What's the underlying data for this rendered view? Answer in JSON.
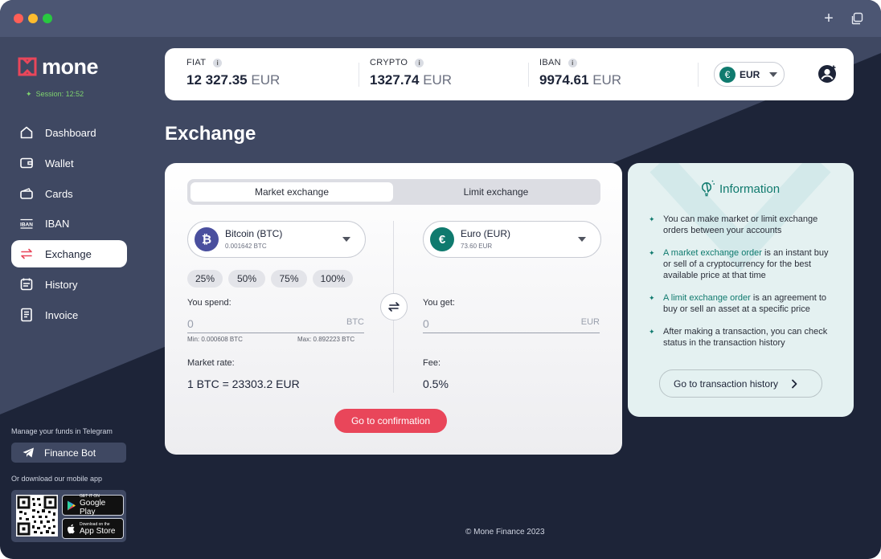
{
  "window": {
    "new_tab_symbol": "+"
  },
  "brand": {
    "name": "mone",
    "session": "Session: 12:52"
  },
  "nav": [
    {
      "label": "Dashboard",
      "icon": "home-icon"
    },
    {
      "label": "Wallet",
      "icon": "wallet-icon"
    },
    {
      "label": "Cards",
      "icon": "cards-icon"
    },
    {
      "label": "IBAN",
      "icon": "iban-icon"
    },
    {
      "label": "Exchange",
      "icon": "exchange-icon",
      "active": true
    },
    {
      "label": "History",
      "icon": "history-icon"
    },
    {
      "label": "Invoice",
      "icon": "invoice-icon"
    }
  ],
  "telegram": {
    "caption": "Manage your funds in Telegram",
    "button": "Finance Bot"
  },
  "mobile": {
    "caption": "Or download our mobile app",
    "google": {
      "small": "GET IT ON",
      "big": "Google Play"
    },
    "apple": {
      "small": "Download on the",
      "big": "App Store"
    }
  },
  "balances": [
    {
      "label": "FIAT",
      "amount": "12 327.35",
      "currency": "EUR"
    },
    {
      "label": "CRYPTO",
      "amount": "1327.74",
      "currency": "EUR"
    },
    {
      "label": "IBAN",
      "amount": "9974.61",
      "currency": "EUR"
    }
  ],
  "info_glyph": "i",
  "currency_select": {
    "symbol": "€",
    "value": "EUR"
  },
  "page": {
    "title": "Exchange"
  },
  "exchange": {
    "tabs": [
      "Market exchange",
      "Limit exchange"
    ],
    "from": {
      "name": "Bitcoin (BTC)",
      "balance": "0.001642 BTC",
      "symbol": "₿"
    },
    "to": {
      "name": "Euro (EUR)",
      "balance": "73.60 EUR",
      "symbol": "€"
    },
    "percents": [
      "25%",
      "50%",
      "75%",
      "100%"
    ],
    "spend_label": "You spend:",
    "spend_value": "0",
    "spend_unit": "BTC",
    "min": "Min: 0.000608 BTC",
    "max": "Max: 0.892223 BTC",
    "get_label": "You get:",
    "get_value": "0",
    "get_unit": "EUR",
    "rate_label": "Market rate:",
    "rate_value": "1 BTC = 23303.2 EUR",
    "fee_label": "Fee:",
    "fee_value": "0.5%",
    "confirm": "Go to confirmation"
  },
  "information": {
    "title": "Information",
    "bullets": [
      {
        "highlight": "",
        "text": "You can make market or limit exchange orders between your accounts"
      },
      {
        "highlight": "A market exchange order",
        "text": " is an instant buy or sell of a cryptocurrency for the best available price at that time"
      },
      {
        "highlight": "A limit exchange order",
        "text": " is an agreement to buy or sell an asset at a specific price"
      },
      {
        "highlight": "",
        "text": "After making a transaction, you can check status in the transaction history"
      }
    ],
    "button": "Go to transaction history"
  },
  "footer": "© Mone Finance 2023",
  "colors": {
    "accent": "#e9465a",
    "teal": "#0f7a6e",
    "bitcoin": "#4a4f9e",
    "background": "#1d2438"
  }
}
